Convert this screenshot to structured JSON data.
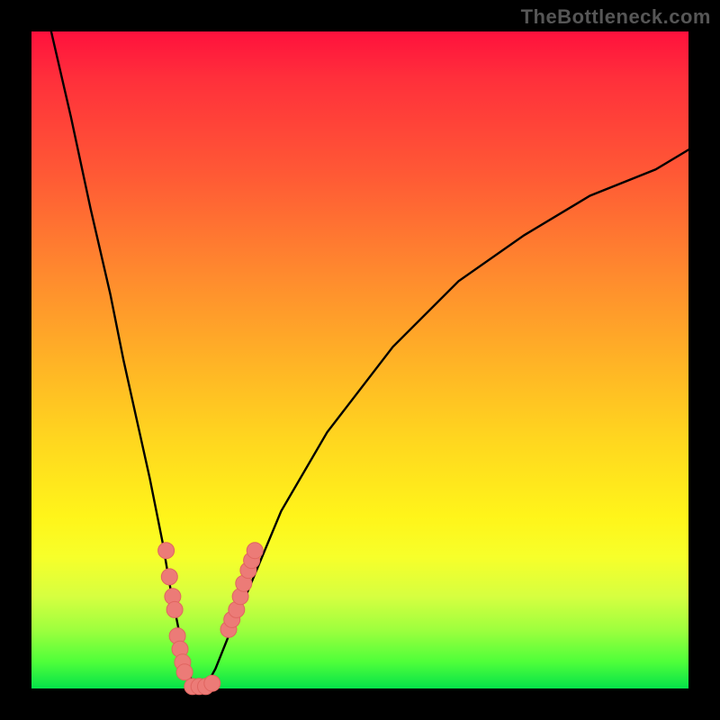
{
  "watermark": "TheBottleneck.com",
  "colors": {
    "page_bg": "#000000",
    "gradient_top": "#ff113d",
    "gradient_bottom": "#05e24a",
    "curve_stroke": "#000000",
    "marker_fill": "#ec7b77",
    "marker_stroke": "#e06560"
  },
  "chart_data": {
    "type": "line",
    "title": "",
    "xlabel": "",
    "ylabel": "",
    "xlim": [
      0,
      100
    ],
    "ylim": [
      0,
      100
    ],
    "grid": false,
    "legend": false,
    "annotations": [
      "TheBottleneck.com"
    ],
    "series": [
      {
        "name": "curve",
        "description": "V-shaped curve (steep descent then shallow rise); y≈0 near minimum",
        "x": [
          3,
          6,
          9,
          12,
          14,
          16,
          18,
          20,
          21,
          22,
          23,
          24,
          25,
          26.5,
          28,
          30,
          33,
          38,
          45,
          55,
          65,
          75,
          85,
          95,
          100
        ],
        "y": [
          100,
          87,
          73,
          60,
          50,
          41,
          32,
          22,
          16,
          11,
          6,
          2,
          0.3,
          0.3,
          3,
          8,
          15,
          27,
          39,
          52,
          62,
          69,
          75,
          79,
          82
        ]
      },
      {
        "name": "left-cluster-markers",
        "description": "salmon dots on left descending arm",
        "x": [
          20.5,
          21.0,
          21.5,
          21.8,
          22.2,
          22.6,
          23.0,
          23.3
        ],
        "y": [
          21,
          17,
          14,
          12,
          8,
          6,
          4,
          2.5
        ]
      },
      {
        "name": "bottom-cluster-markers",
        "description": "salmon dots at the minimum",
        "x": [
          24.5,
          25.5,
          26.5,
          27.5
        ],
        "y": [
          0.3,
          0.3,
          0.3,
          0.8
        ]
      },
      {
        "name": "right-cluster-markers",
        "description": "salmon dots on right ascending arm",
        "x": [
          30.0,
          30.5,
          31.2,
          31.8,
          32.3,
          33.0,
          33.5,
          34.0
        ],
        "y": [
          9,
          10.5,
          12,
          14,
          16,
          18,
          19.5,
          21
        ]
      }
    ]
  }
}
